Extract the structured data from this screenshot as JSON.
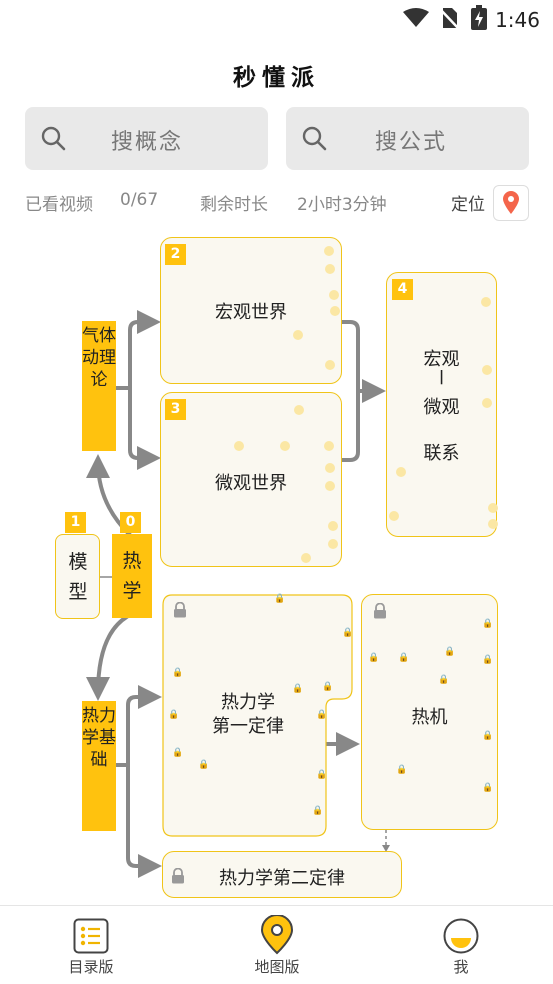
{
  "status_bar": {
    "time": "1:46"
  },
  "app": {
    "title": "秒懂派"
  },
  "search": {
    "concept_placeholder": "搜概念",
    "formula_placeholder": "搜公式"
  },
  "stats": {
    "watched_label": "已看视频",
    "watched_value": "0/67",
    "remaining_label": "剩余时长",
    "remaining_value": "2小时3分钟",
    "locate_label": "定位"
  },
  "colors": {
    "accent": "#ffc20e",
    "card_bg": "#faf8f0",
    "card_border": "#f0c419",
    "connector": "#888888",
    "pin": "#f4654b"
  },
  "map": {
    "nodes": [
      {
        "num": "0",
        "label": "热学"
      },
      {
        "num": "1",
        "label": "模型"
      },
      {
        "num": "2",
        "label": "宏观世界"
      },
      {
        "num": "3",
        "label": "微观世界"
      },
      {
        "num": "4",
        "label_top": "宏观",
        "label_bar": "|",
        "label_mid": "微观",
        "label_bottom": "联系"
      }
    ],
    "tags": [
      {
        "label": "气体动理论"
      },
      {
        "label": "热力学基础"
      }
    ],
    "locked_nodes": [
      {
        "label_line1": "热力学",
        "label_line2": "第一定律"
      },
      {
        "label": "热机"
      },
      {
        "label": "热力学第二定律"
      }
    ]
  },
  "tabbar": {
    "items": [
      {
        "label": "目录版"
      },
      {
        "label": "地图版"
      },
      {
        "label": "我"
      }
    ]
  }
}
